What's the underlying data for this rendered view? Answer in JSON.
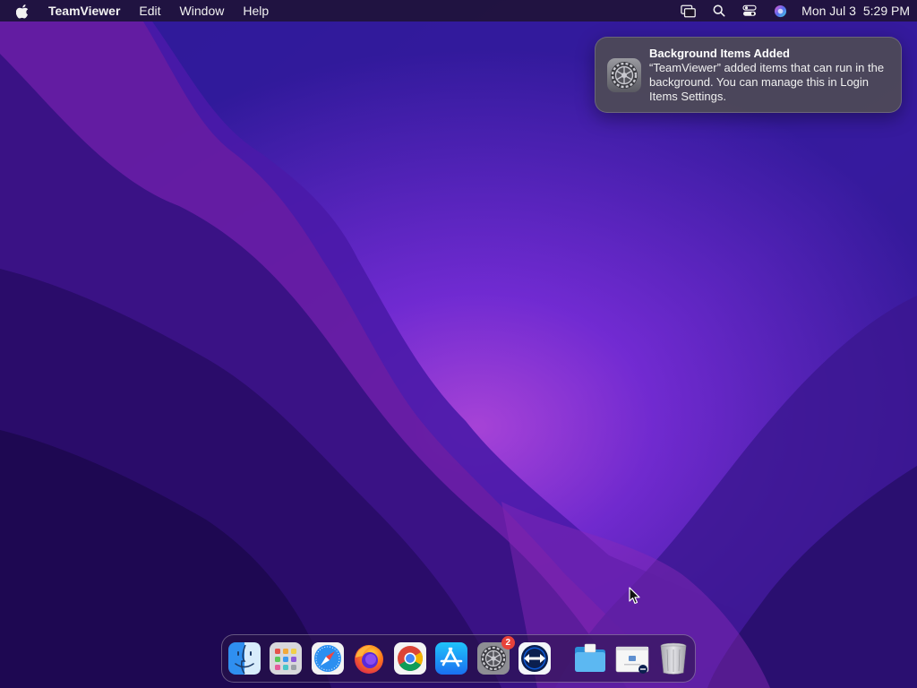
{
  "menubar": {
    "apple_icon": "apple-logo-icon",
    "app_name": "TeamViewer",
    "items": [
      "Edit",
      "Window",
      "Help"
    ],
    "status_icons": [
      "screen-mirroring-icon",
      "search-icon",
      "control-center-icon",
      "siri-icon"
    ],
    "clock": {
      "date": "Mon Jul 3",
      "time": "5:29 PM"
    }
  },
  "notification": {
    "icon": "system-settings-gear-icon",
    "title": "Background Items Added",
    "body": "“TeamViewer” added items that can run in the background. You can manage this in Login Items Settings."
  },
  "dock": {
    "apps": [
      {
        "name": "Finder",
        "icon": "finder-icon"
      },
      {
        "name": "Launchpad",
        "icon": "launchpad-icon"
      },
      {
        "name": "Safari",
        "icon": "safari-icon"
      },
      {
        "name": "Firefox",
        "icon": "firefox-icon"
      },
      {
        "name": "Google Chrome",
        "icon": "chrome-icon"
      },
      {
        "name": "App Store",
        "icon": "app-store-icon"
      },
      {
        "name": "System Settings",
        "icon": "system-settings-icon",
        "badge": "2"
      },
      {
        "name": "TeamViewer",
        "icon": "teamviewer-icon"
      }
    ],
    "others": [
      {
        "name": "Downloads",
        "icon": "downloads-folder-icon"
      },
      {
        "name": "TeamViewer Installer",
        "icon": "installer-window-icon"
      },
      {
        "name": "Trash",
        "icon": "trash-icon"
      }
    ]
  },
  "colors": {
    "accent_purple": "#6a1fc9",
    "badge_red": "#e8423a",
    "teamviewer_blue": "#0e5bd8"
  }
}
